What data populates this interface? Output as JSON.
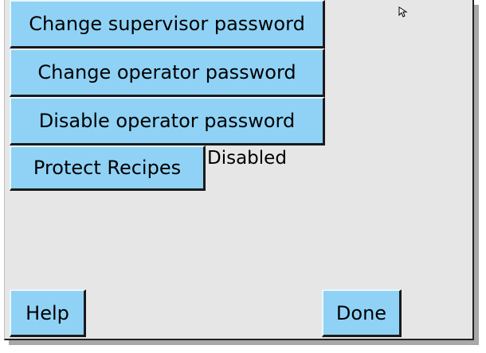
{
  "buttons": {
    "change_supervisor_password": "Change supervisor password",
    "change_operator_password": "Change operator password",
    "disable_operator_password": "Disable operator password",
    "protect_recipes": "Protect Recipes",
    "help": "Help",
    "done": "Done"
  },
  "protect_recipes_status": "Disabled",
  "colors": {
    "button_fill": "#8fd2f6",
    "panel_bg": "#e6e6e6"
  },
  "icons": {
    "pointer": "mouse-pointer-icon"
  }
}
